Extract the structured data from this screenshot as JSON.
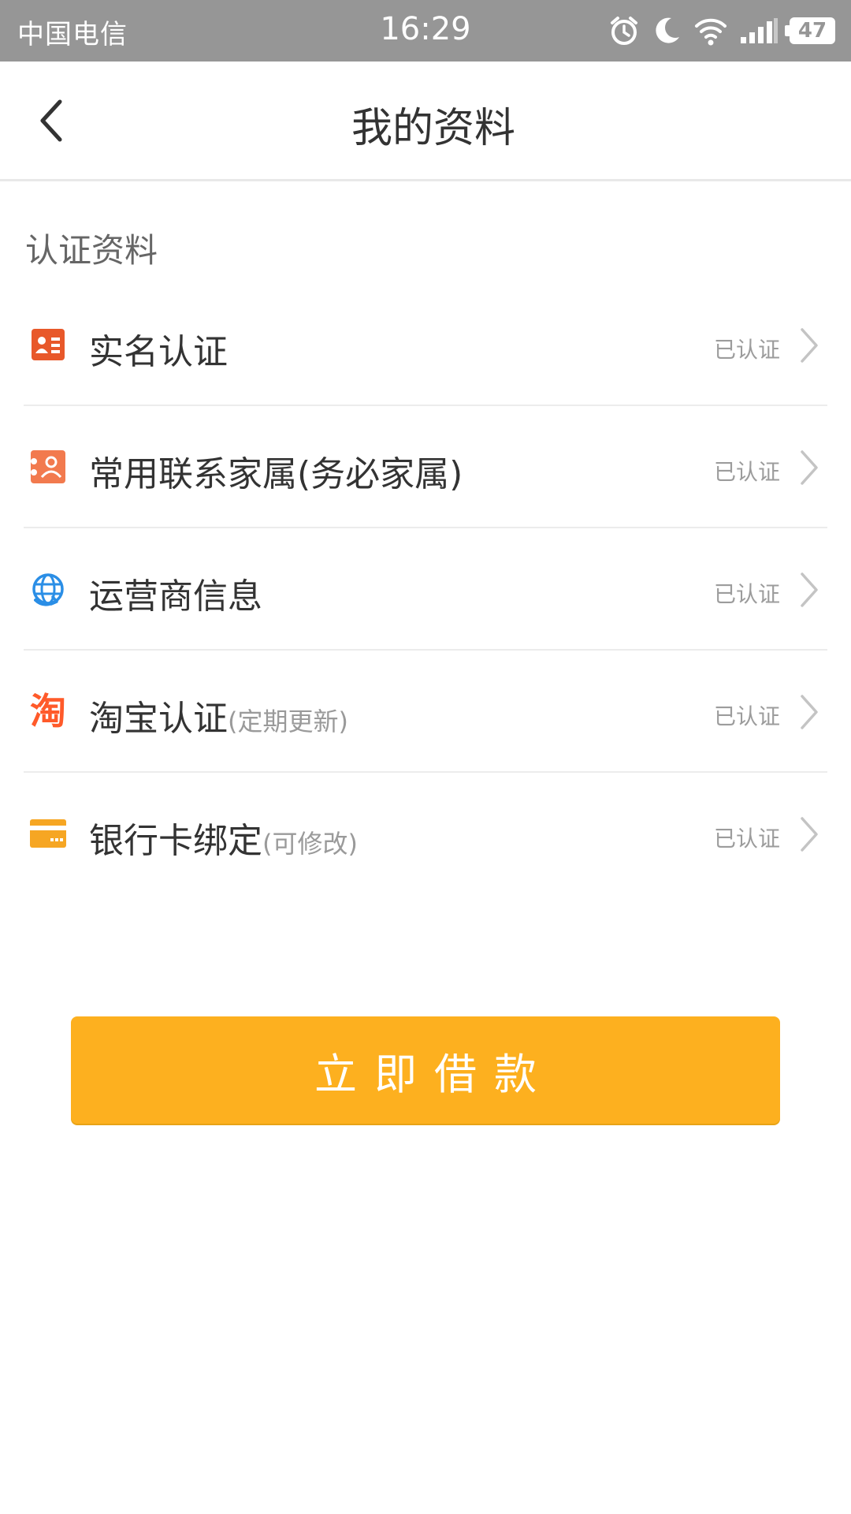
{
  "status_bar": {
    "carrier": "中国电信",
    "time": "16:29",
    "battery": "47",
    "icons": [
      "alarm-icon",
      "moon-icon",
      "wifi-icon",
      "signal-icon",
      "battery-icon"
    ]
  },
  "header": {
    "title": "我的资料",
    "back_icon": "chevron-left-icon"
  },
  "section": {
    "title": "认证资料"
  },
  "items": [
    {
      "label": "实名认证",
      "note": "",
      "status": "已认证",
      "icon": "id-card-icon",
      "icon_color": "#e8582a"
    },
    {
      "label": "常用联系家属(务必家属)",
      "note": "",
      "status": "已认证",
      "icon": "contact-icon",
      "icon_color": "#f27a4e"
    },
    {
      "label": "运营商信息",
      "note": "",
      "status": "已认证",
      "icon": "globe-icon",
      "icon_color": "#2a8ee6"
    },
    {
      "label": "淘宝认证",
      "note": "(定期更新)",
      "status": "已认证",
      "icon": "taobao-icon",
      "icon_text": "淘",
      "icon_color": "#ff5a2a"
    },
    {
      "label": "银行卡绑定",
      "note": "(可修改)",
      "status": "已认证",
      "icon": "bank-card-icon",
      "icon_color": "#f6a623"
    }
  ],
  "button": {
    "label": "立即借款",
    "color": "#fdb01f"
  }
}
